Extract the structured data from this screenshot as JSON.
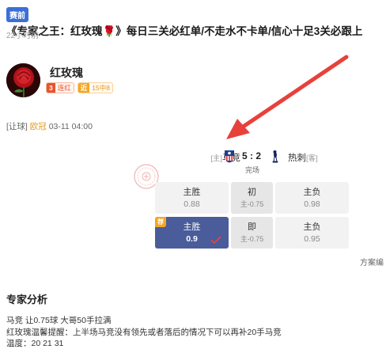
{
  "header": {
    "tag": "赛前",
    "title": "《专家之王：红玫瑰🌹》每日三关必红单/不走水不卡单/信心十足3关必跟上",
    "time": "22小时前"
  },
  "author": {
    "name": "红玫瑰",
    "streak_count": "3",
    "streak_label": "连红",
    "recent_prefix": "近",
    "recent_label": "15中8"
  },
  "match": {
    "market": "[让球]",
    "league": "欧冠",
    "datetime": "03-11 04:00",
    "home_team": "马竞",
    "home_tag": "[主]",
    "away_team": "热刺",
    "away_tag": "[客]",
    "score": "5 : 2",
    "status": "完场"
  },
  "odds": {
    "row1": {
      "home_label": "主胜",
      "home_value": "0.88",
      "mid_label": "初",
      "mid_value": "主-0.75",
      "away_label": "主负",
      "away_value": "0.98"
    },
    "row2": {
      "rec_tag": "荐",
      "home_label": "主胜",
      "home_value": "0.9",
      "mid_label": "即",
      "mid_value": "主-0.75",
      "away_label": "主负",
      "away_value": "0.95"
    }
  },
  "more_link": "方案编",
  "analysis": {
    "title": "专家分析",
    "line1": "马竞 让0.75球 大哥50手拉满",
    "line2": "红玫瑰温馨提醒：上半场马竞没有领先或者落后的情况下可以再补20手马竞",
    "line3": "温度：20 21 31"
  },
  "colors": {
    "tag_blue": "#3a6fd8",
    "selected_cell": "#4a5c9a",
    "accent_orange": "#f5a623",
    "arrow_red": "#e8413b"
  }
}
